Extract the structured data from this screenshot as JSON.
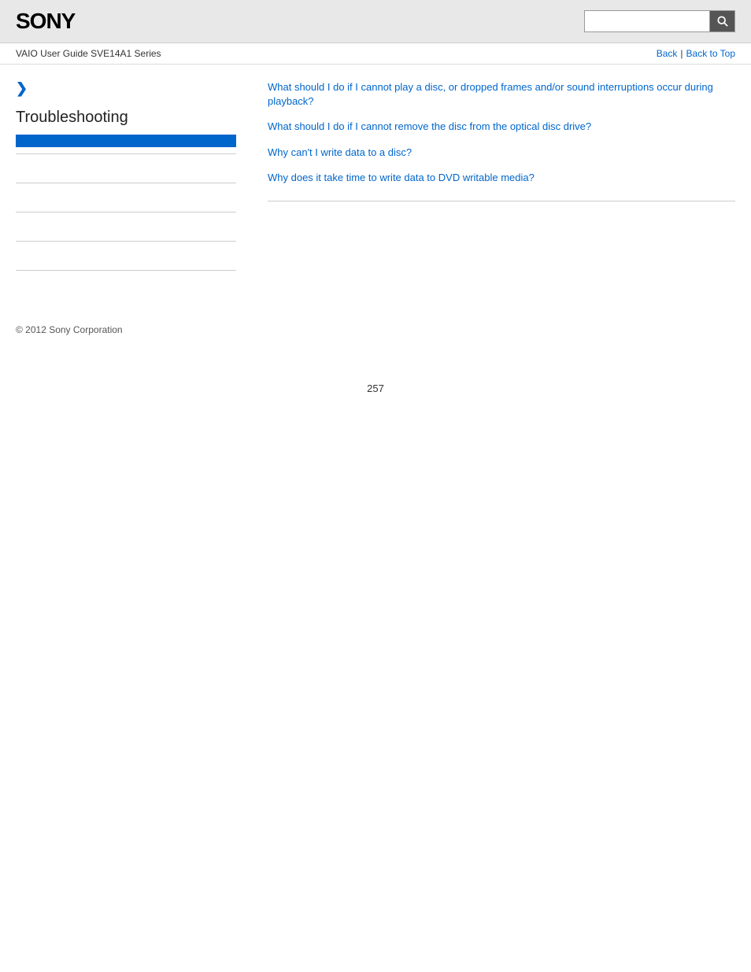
{
  "header": {
    "logo": "SONY",
    "search_placeholder": "",
    "search_icon": "🔍"
  },
  "nav": {
    "guide_title": "VAIO User Guide SVE14A1 Series",
    "back_label": "Back",
    "back_to_top_label": "Back to Top",
    "separator": "|"
  },
  "sidebar": {
    "breadcrumb_icon": "❯",
    "section_title": "Troubleshooting",
    "active_item": "",
    "dividers": [
      "",
      "",
      "",
      "",
      ""
    ]
  },
  "content": {
    "links": [
      {
        "text": "What should I do if I cannot play a disc, or dropped frames and/or sound interruptions occur during playback?"
      },
      {
        "text": "What should I do if I cannot remove the disc from the optical disc drive?"
      },
      {
        "text": "Why can't I write data to a disc?"
      },
      {
        "text": "Why does it take time to write data to DVD writable media?"
      }
    ]
  },
  "footer": {
    "copyright": "© 2012 Sony Corporation"
  },
  "page_number": "257"
}
